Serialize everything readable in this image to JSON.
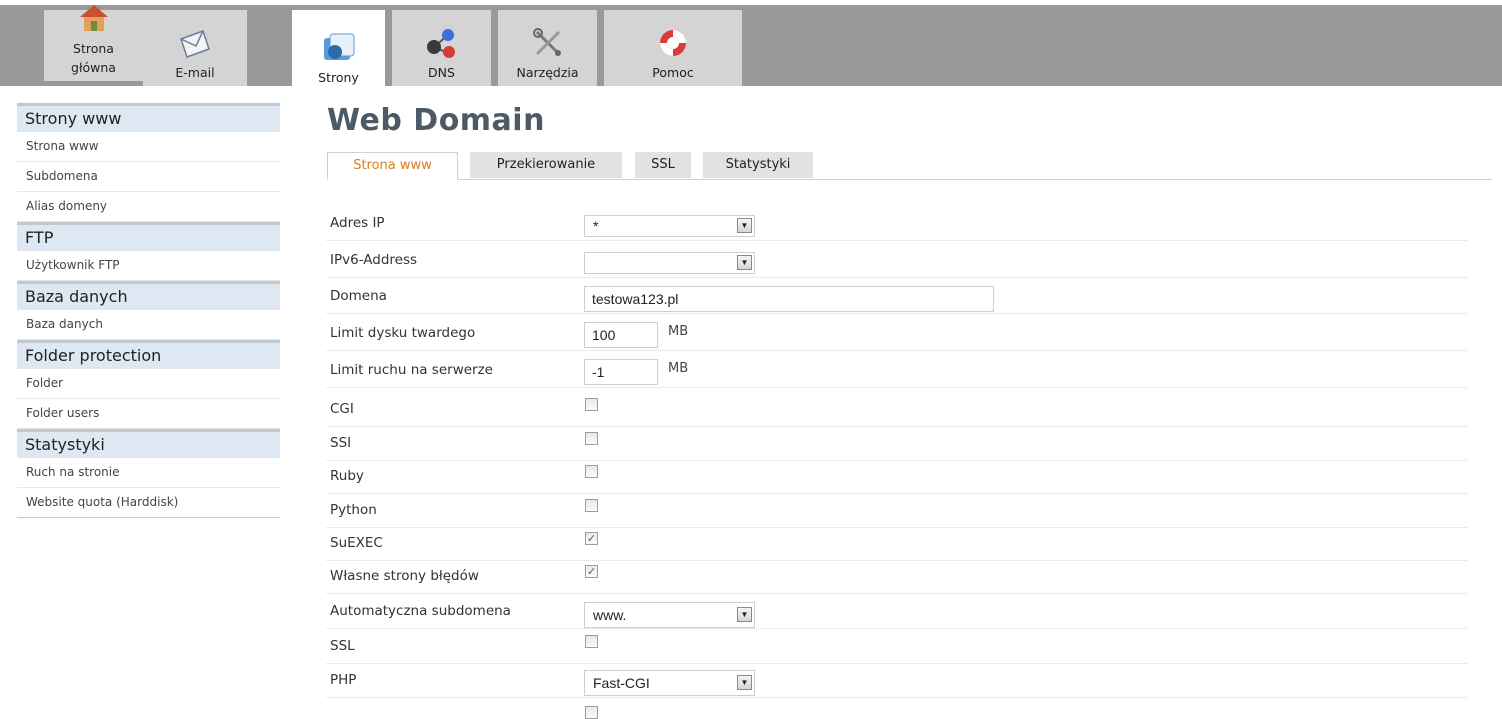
{
  "nav": {
    "tabs": [
      {
        "label_line1": "Strona",
        "label_line2": "główna",
        "icon": "home-icon"
      },
      {
        "label": "E-mail",
        "icon": "envelope-icon"
      },
      {
        "label": "Strony",
        "icon": "sites-icon"
      },
      {
        "label": "DNS",
        "icon": "network-icon"
      },
      {
        "label": "Narzędzia",
        "icon": "tools-icon"
      },
      {
        "label": "Pomoc",
        "icon": "lifebuoy-icon"
      }
    ]
  },
  "sidebar": {
    "sections": [
      {
        "title": "Strony www",
        "items": [
          "Strona www",
          "Subdomena",
          "Alias domeny"
        ]
      },
      {
        "title": "FTP",
        "items": [
          "Użytkownik FTP"
        ]
      },
      {
        "title": "Baza danych",
        "items": [
          "Baza danych"
        ]
      },
      {
        "title": "Folder protection",
        "items": [
          "Folder",
          "Folder users"
        ]
      },
      {
        "title": "Statystyki",
        "items": [
          "Ruch na stronie",
          "Website quota (Harddisk)"
        ]
      }
    ]
  },
  "main": {
    "title": "Web Domain",
    "tabs": [
      "Strona www",
      "Przekierowanie",
      "SSL",
      "Statystyki"
    ],
    "form": {
      "ip_label": "Adres IP",
      "ip_value": "*",
      "ipv6_label": "IPv6-Address",
      "ipv6_value": "",
      "domain_label": "Domena",
      "domain_value": "testowa123.pl",
      "disk_label": "Limit dysku twardego",
      "disk_value": "100",
      "disk_unit": "MB",
      "traffic_label": "Limit ruchu na serwerze",
      "traffic_value": "-1",
      "traffic_unit": "MB",
      "cgi_label": "CGI",
      "cgi_checked": false,
      "ssi_label": "SSI",
      "ssi_checked": false,
      "ruby_label": "Ruby",
      "ruby_checked": false,
      "python_label": "Python",
      "python_checked": false,
      "suexec_label": "SuEXEC",
      "suexec_checked": true,
      "errors_label": "Własne strony błędów",
      "errors_checked": true,
      "autosub_label": "Automatyczna subdomena",
      "autosub_value": "www.",
      "ssl_label": "SSL",
      "ssl_checked": false,
      "php_label": "PHP",
      "php_value": "Fast-CGI"
    }
  },
  "colors": {
    "topbar": "#999999",
    "tab_active_text": "#e07a1f",
    "sidebar_header": "#dde8f2",
    "title": "#4d5a66"
  }
}
